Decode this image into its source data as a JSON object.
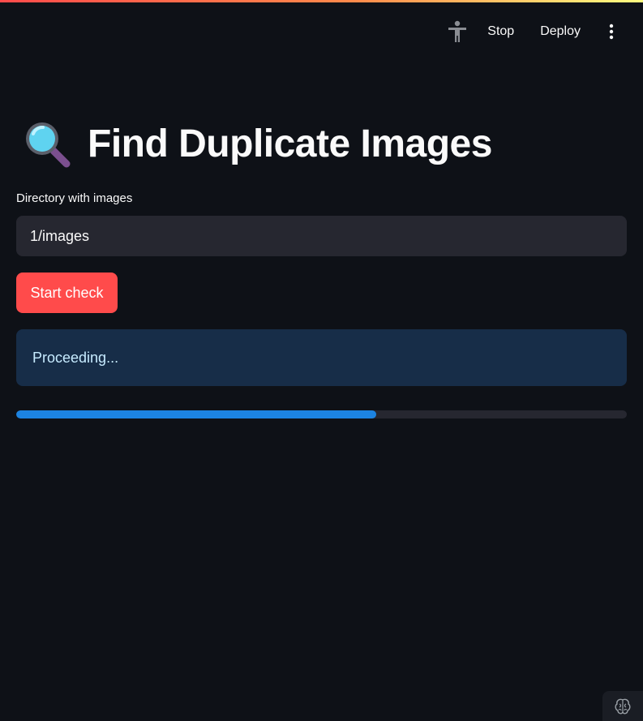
{
  "header": {
    "stop_label": "Stop",
    "deploy_label": "Deploy",
    "status_icon": "running-figure-icon",
    "menu_icon": "kebab-menu-icon"
  },
  "main": {
    "title_icon": "magnifying-glass-emoji",
    "title": "Find Duplicate Images",
    "directory_field": {
      "label": "Directory with images",
      "value": "1/images"
    },
    "start_button_label": "Start check",
    "status_message": "Proceeding...",
    "progress": 0.59
  },
  "footer": {
    "badge_icon": "brain-icon"
  },
  "colors": {
    "background": "#0e1117",
    "primary": "#ff4b4b",
    "info_background": "#172d48",
    "info_text": "#c7ebff",
    "progress_fill": "#1c83e1",
    "input_background": "#262730"
  }
}
